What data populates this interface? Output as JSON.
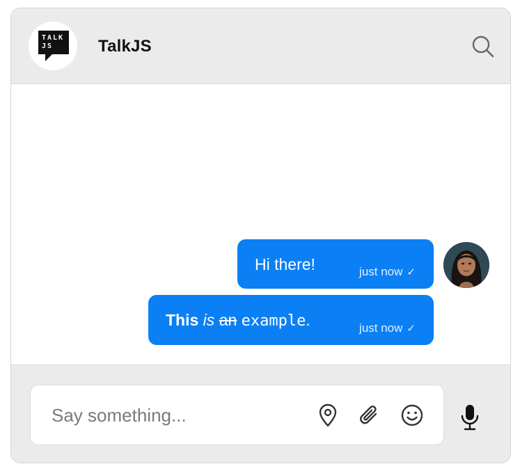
{
  "header": {
    "logo_text_line1": "TALK",
    "logo_text_line2": "JS",
    "title": "TalkJS"
  },
  "messages": [
    {
      "text": "Hi there!",
      "time": "just now",
      "status": "sent-check"
    },
    {
      "text_parts": {
        "bold": "This",
        "italic": "is",
        "strike": "an",
        "code": "example",
        "tail": "."
      },
      "time": "just now",
      "status": "sent-check"
    }
  ],
  "composer": {
    "placeholder": "Say something..."
  },
  "colors": {
    "bubble": "#0b80f5",
    "header_bg": "#ebebeb",
    "composer_bg": "#ebebeb"
  },
  "icons": {
    "search": "search-icon",
    "location": "location-pin-icon",
    "attach": "paperclip-icon",
    "emoji": "smiley-icon",
    "mic": "microphone-icon",
    "check": "checkmark-icon"
  }
}
